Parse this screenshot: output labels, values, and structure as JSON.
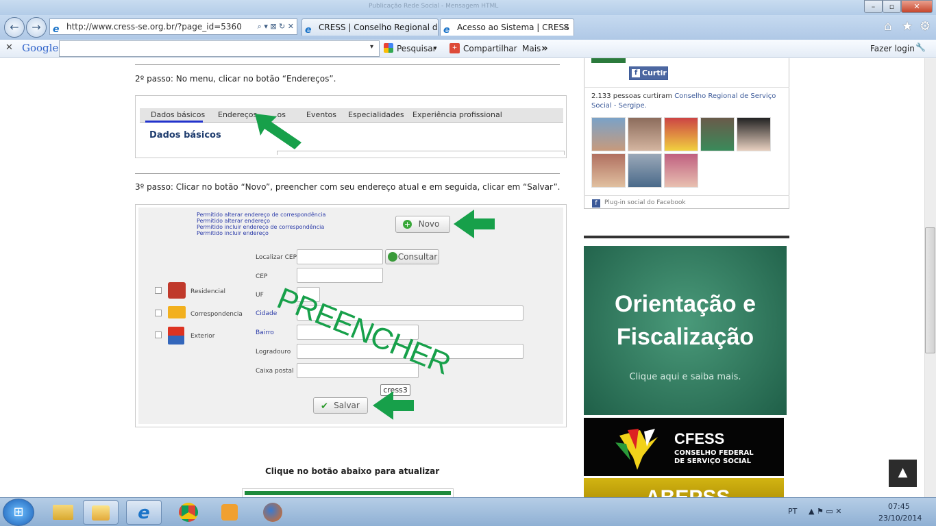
{
  "window": {
    "title": "Publicação Rede Social - Mensagem HTML",
    "minimize": "–",
    "maximize": "▫",
    "close": "✕"
  },
  "browser": {
    "back": "←",
    "forward": "→",
    "address": "http://www.cress-se.org.br/?page_id=5360",
    "addr_icons": "⌕ ▾ ⊠ ↻ ✕",
    "tabs": [
      {
        "label": "CRESS | Conselho Regional de ..."
      },
      {
        "label": "Acesso ao Sistema | CRESS"
      }
    ],
    "tab_close": "✕",
    "right_icons": {
      "home": "⌂",
      "favorites": "★",
      "tools": "⚙"
    }
  },
  "google_toolbar": {
    "close": "✕",
    "logo": "Google",
    "search_placeholder": "",
    "dropdown": "▾",
    "pesquisar": "Pesquisar",
    "compartilhar": "Compartilhar",
    "mais": "Mais",
    "mais_icon": "»",
    "fazer_login": "Fazer login",
    "wrench": "🔧"
  },
  "content": {
    "step2": "2º passo: No menu, clicar no botão “Endereços”.",
    "tabs_fig": [
      "Dados básicos",
      "Endereços",
      "...os",
      "Eventos",
      "Especialidades",
      "Experiência profissional"
    ],
    "dados_basicos": "Dados básicos",
    "step3": "3º passo: Clicar no botão “Novo”, preencher com seu endereço atual e em seguida, clicar em “Salvar”.",
    "permissions": [
      "Permitido alterar endereço de correspondência",
      "Permitido alterar endereço",
      "Permitido incluir endereço de correspondência",
      "Permitido incluir endereço"
    ],
    "novo": "Novo",
    "consultar": "Consultar",
    "fields": [
      "Localizar CEP",
      "CEP",
      "UF",
      "Cidade",
      "Bairro",
      "Logradouro",
      "Caixa postal"
    ],
    "types": [
      "Residencial",
      "Correspondencia",
      "Exterior"
    ],
    "preencher": "PREENCHER",
    "tooltip": "cress3",
    "salvar": "Salvar",
    "update_heading": "Clique no botão abaixo para atualizar"
  },
  "sidebar": {
    "curtir": "Curtir",
    "likes_count": "2.133 pessoas curtiram",
    "likes_page": "Conselho Regional de Serviço Social - Sergipe.",
    "plugin": "Plug-in social do Facebook",
    "banner_title1": "Orientação e",
    "banner_title2": "Fiscalização",
    "banner_sub": "Clique aqui e saiba mais.",
    "cfess_big": "CFESS",
    "cfess_l1": "CONSELHO FEDERAL",
    "cfess_l2": "DE SERVIÇO SOCIAL",
    "abepss": "ABEPSS",
    "back_top": "▲"
  },
  "taskbar": {
    "start": "⊞",
    "lang": "PT",
    "tray": "▲  ⚑  ▭  ✕",
    "time": "07:45",
    "date": "23/10/2014"
  },
  "colors": {
    "green": "#17a04a",
    "fb_blue": "#3b5998",
    "banner_green": "#2f7a5f"
  }
}
